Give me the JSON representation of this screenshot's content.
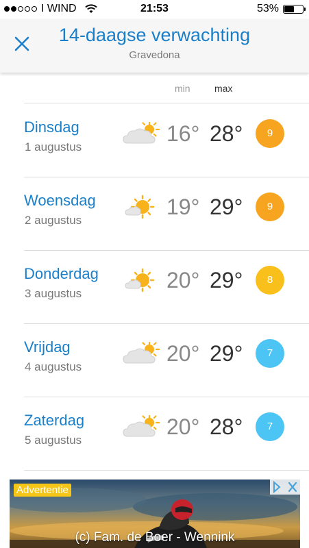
{
  "status_bar": {
    "carrier": "I WIND",
    "time": "21:53",
    "battery": "53%",
    "signal_bars": 2,
    "battery_level": 0.53
  },
  "header": {
    "title": "14-daagse verwachting",
    "location": "Gravedona",
    "close_icon": "close-icon"
  },
  "columns": {
    "min": "min",
    "max": "max"
  },
  "days": [
    {
      "day": "Dinsdag",
      "date": "1 augustus",
      "icon": "partly-cloudy-icon",
      "min": "16°",
      "max": "28°",
      "score": "9",
      "score_color": "#f7a520"
    },
    {
      "day": "Woensdag",
      "date": "2 augustus",
      "icon": "sunny-cloud-icon",
      "min": "19°",
      "max": "29°",
      "score": "9",
      "score_color": "#f7a520"
    },
    {
      "day": "Donderdag",
      "date": "3 augustus",
      "icon": "sunny-cloud-icon",
      "min": "20°",
      "max": "29°",
      "score": "8",
      "score_color": "#f9c01c"
    },
    {
      "day": "Vrijdag",
      "date": "4 augustus",
      "icon": "partly-cloudy-icon",
      "min": "20°",
      "max": "29°",
      "score": "7",
      "score_color": "#4cc4f4"
    },
    {
      "day": "Zaterdag",
      "date": "5 augustus",
      "icon": "partly-cloudy-icon",
      "min": "20°",
      "max": "28°",
      "score": "7",
      "score_color": "#4cc4f4"
    }
  ],
  "ad": {
    "label": "Advertentie",
    "credit": "(c) Fam. de Boer - Wennink"
  },
  "colors": {
    "accent": "#1a7fc8",
    "header_bg": "#f6f6f6"
  }
}
